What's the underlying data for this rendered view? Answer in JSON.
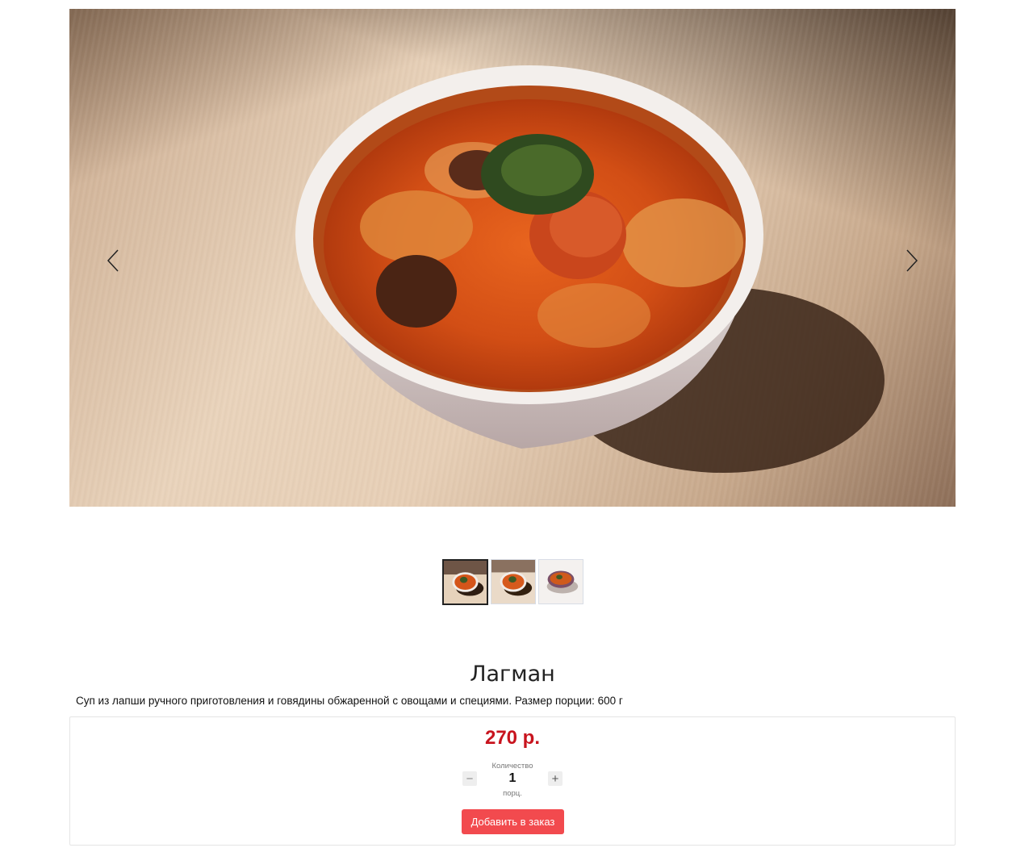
{
  "gallery": {
    "main_image_icon": "lagman-soup-photo",
    "prev_icon": "chevron-left-icon",
    "next_icon": "chevron-right-icon",
    "thumbnails": [
      {
        "icon": "lagman-thumb-1",
        "active": true
      },
      {
        "icon": "lagman-thumb-2",
        "active": false
      },
      {
        "icon": "lagman-thumb-3",
        "active": false
      }
    ]
  },
  "product": {
    "title": "Лагман",
    "description": "Суп из лапши ручного приготовления и говядины обжаренной с овощами и специями. Размер порции: 600 г",
    "price": "270 р.",
    "quantity_label": "Количество",
    "quantity": "1",
    "unit": "порц.",
    "minus_label": "−",
    "plus_label": "+",
    "add_button_label": "Добавить в заказ"
  },
  "colors": {
    "price": "#c8141e",
    "add_button": "#f24a4e"
  }
}
